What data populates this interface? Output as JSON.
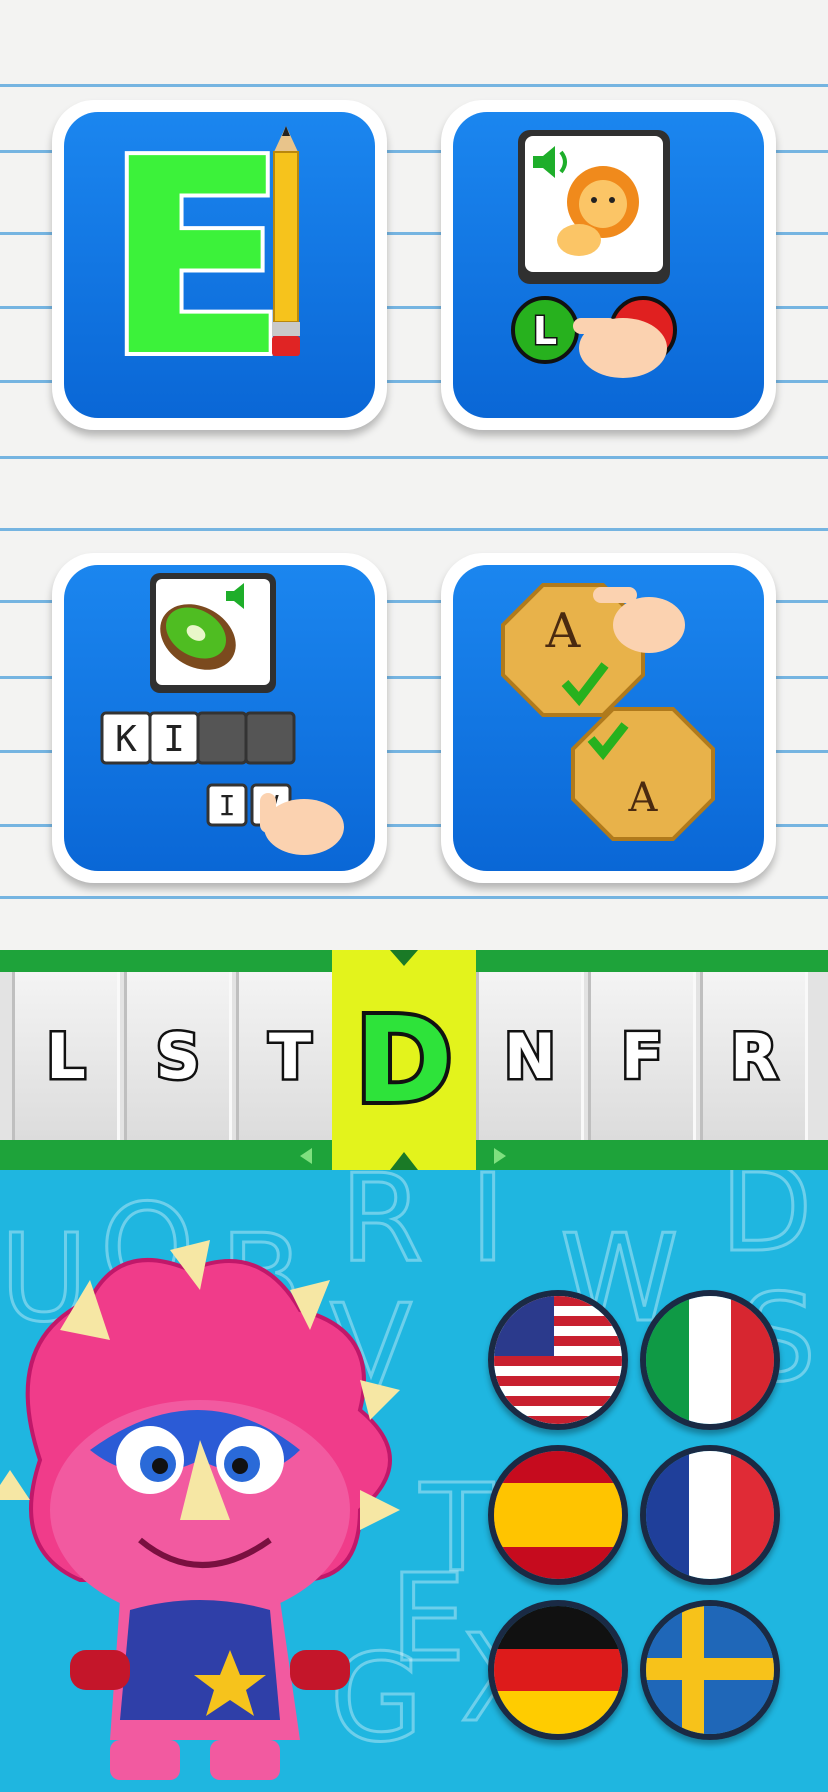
{
  "activities": [
    {
      "name": "letter-tracing",
      "letter": "E"
    },
    {
      "name": "sound-match",
      "choice": "L"
    },
    {
      "name": "spell-word",
      "tiles": [
        "K",
        "I",
        "",
        ""
      ],
      "options": [
        "I",
        "V"
      ]
    },
    {
      "name": "letter-match",
      "letters": [
        "A",
        "A"
      ]
    }
  ],
  "letter_strip": {
    "letters": [
      "L",
      "S",
      "T",
      "D",
      "N",
      "F",
      "R"
    ],
    "selected": "D"
  },
  "colors": {
    "paper": "#f3f3f2",
    "tile_blue": "#1b86ef",
    "strip_green": "#1ea33a",
    "highlight": "#e3f31c",
    "sky": "#1fb6e0"
  },
  "languages": [
    {
      "name": "English (US)",
      "icon": "us-flag-icon"
    },
    {
      "name": "Italian",
      "icon": "italy-flag-icon"
    },
    {
      "name": "Spanish",
      "icon": "spain-flag-icon"
    },
    {
      "name": "French",
      "icon": "france-flag-icon"
    },
    {
      "name": "German",
      "icon": "germany-flag-icon"
    },
    {
      "name": "Swedish",
      "icon": "sweden-flag-icon"
    }
  ],
  "background_letters": [
    "U",
    "O",
    "B",
    "R",
    "I",
    "W",
    "D",
    "V",
    "T",
    "E",
    "G",
    "X",
    "S"
  ]
}
